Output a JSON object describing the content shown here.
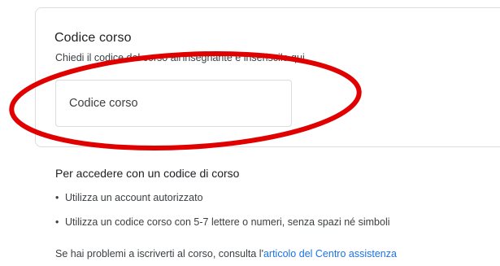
{
  "card": {
    "title": "Codice corso",
    "description": "Chiedi il codice del corso all'insegnante e inseriscilo qui.",
    "input_placeholder": "Codice corso",
    "input_value": ""
  },
  "annotation": {
    "color": "#e00000",
    "shape": "ellipse"
  },
  "help": {
    "title": "Per accedere con un codice di corso",
    "items": [
      {
        "bullet": "•",
        "text": "Utilizza un account autorizzato"
      },
      {
        "bullet": "•",
        "text": "Utilizza un codice corso con 5-7 lettere o numeri, senza spazi né simboli"
      }
    ],
    "footer_prefix": "Se hai problemi a iscriverti al corso, consulta l'",
    "footer_link": "articolo del Centro assistenza"
  },
  "colors": {
    "link": "#1a73e8",
    "border": "#dadce0",
    "text": "#202124"
  }
}
